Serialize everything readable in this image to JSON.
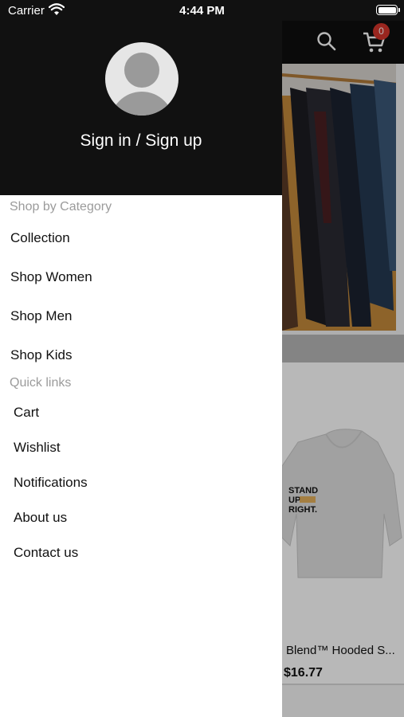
{
  "status_bar": {
    "carrier": "Carrier",
    "time": "4:44 PM"
  },
  "header": {
    "cart_count": "0"
  },
  "drawer": {
    "sign_in_label": "Sign in / Sign up",
    "shop_by_category_title": "Shop by Category",
    "categories": [
      "Collection",
      "Shop Women",
      "Shop Men",
      "Shop Kids"
    ],
    "quick_links_title": "Quick links",
    "quick_links": [
      "Cart",
      "Wishlist",
      "Notifications",
      "About us",
      "Contact us"
    ]
  },
  "product": {
    "name": "Blend™ Hooded S...",
    "price": "$16.77",
    "print_text": [
      "STAND",
      "UP",
      "RIGHT."
    ]
  },
  "colors": {
    "header_bg": "#111111",
    "badge": "#d4352b",
    "section_title": "#9b9b9b"
  }
}
